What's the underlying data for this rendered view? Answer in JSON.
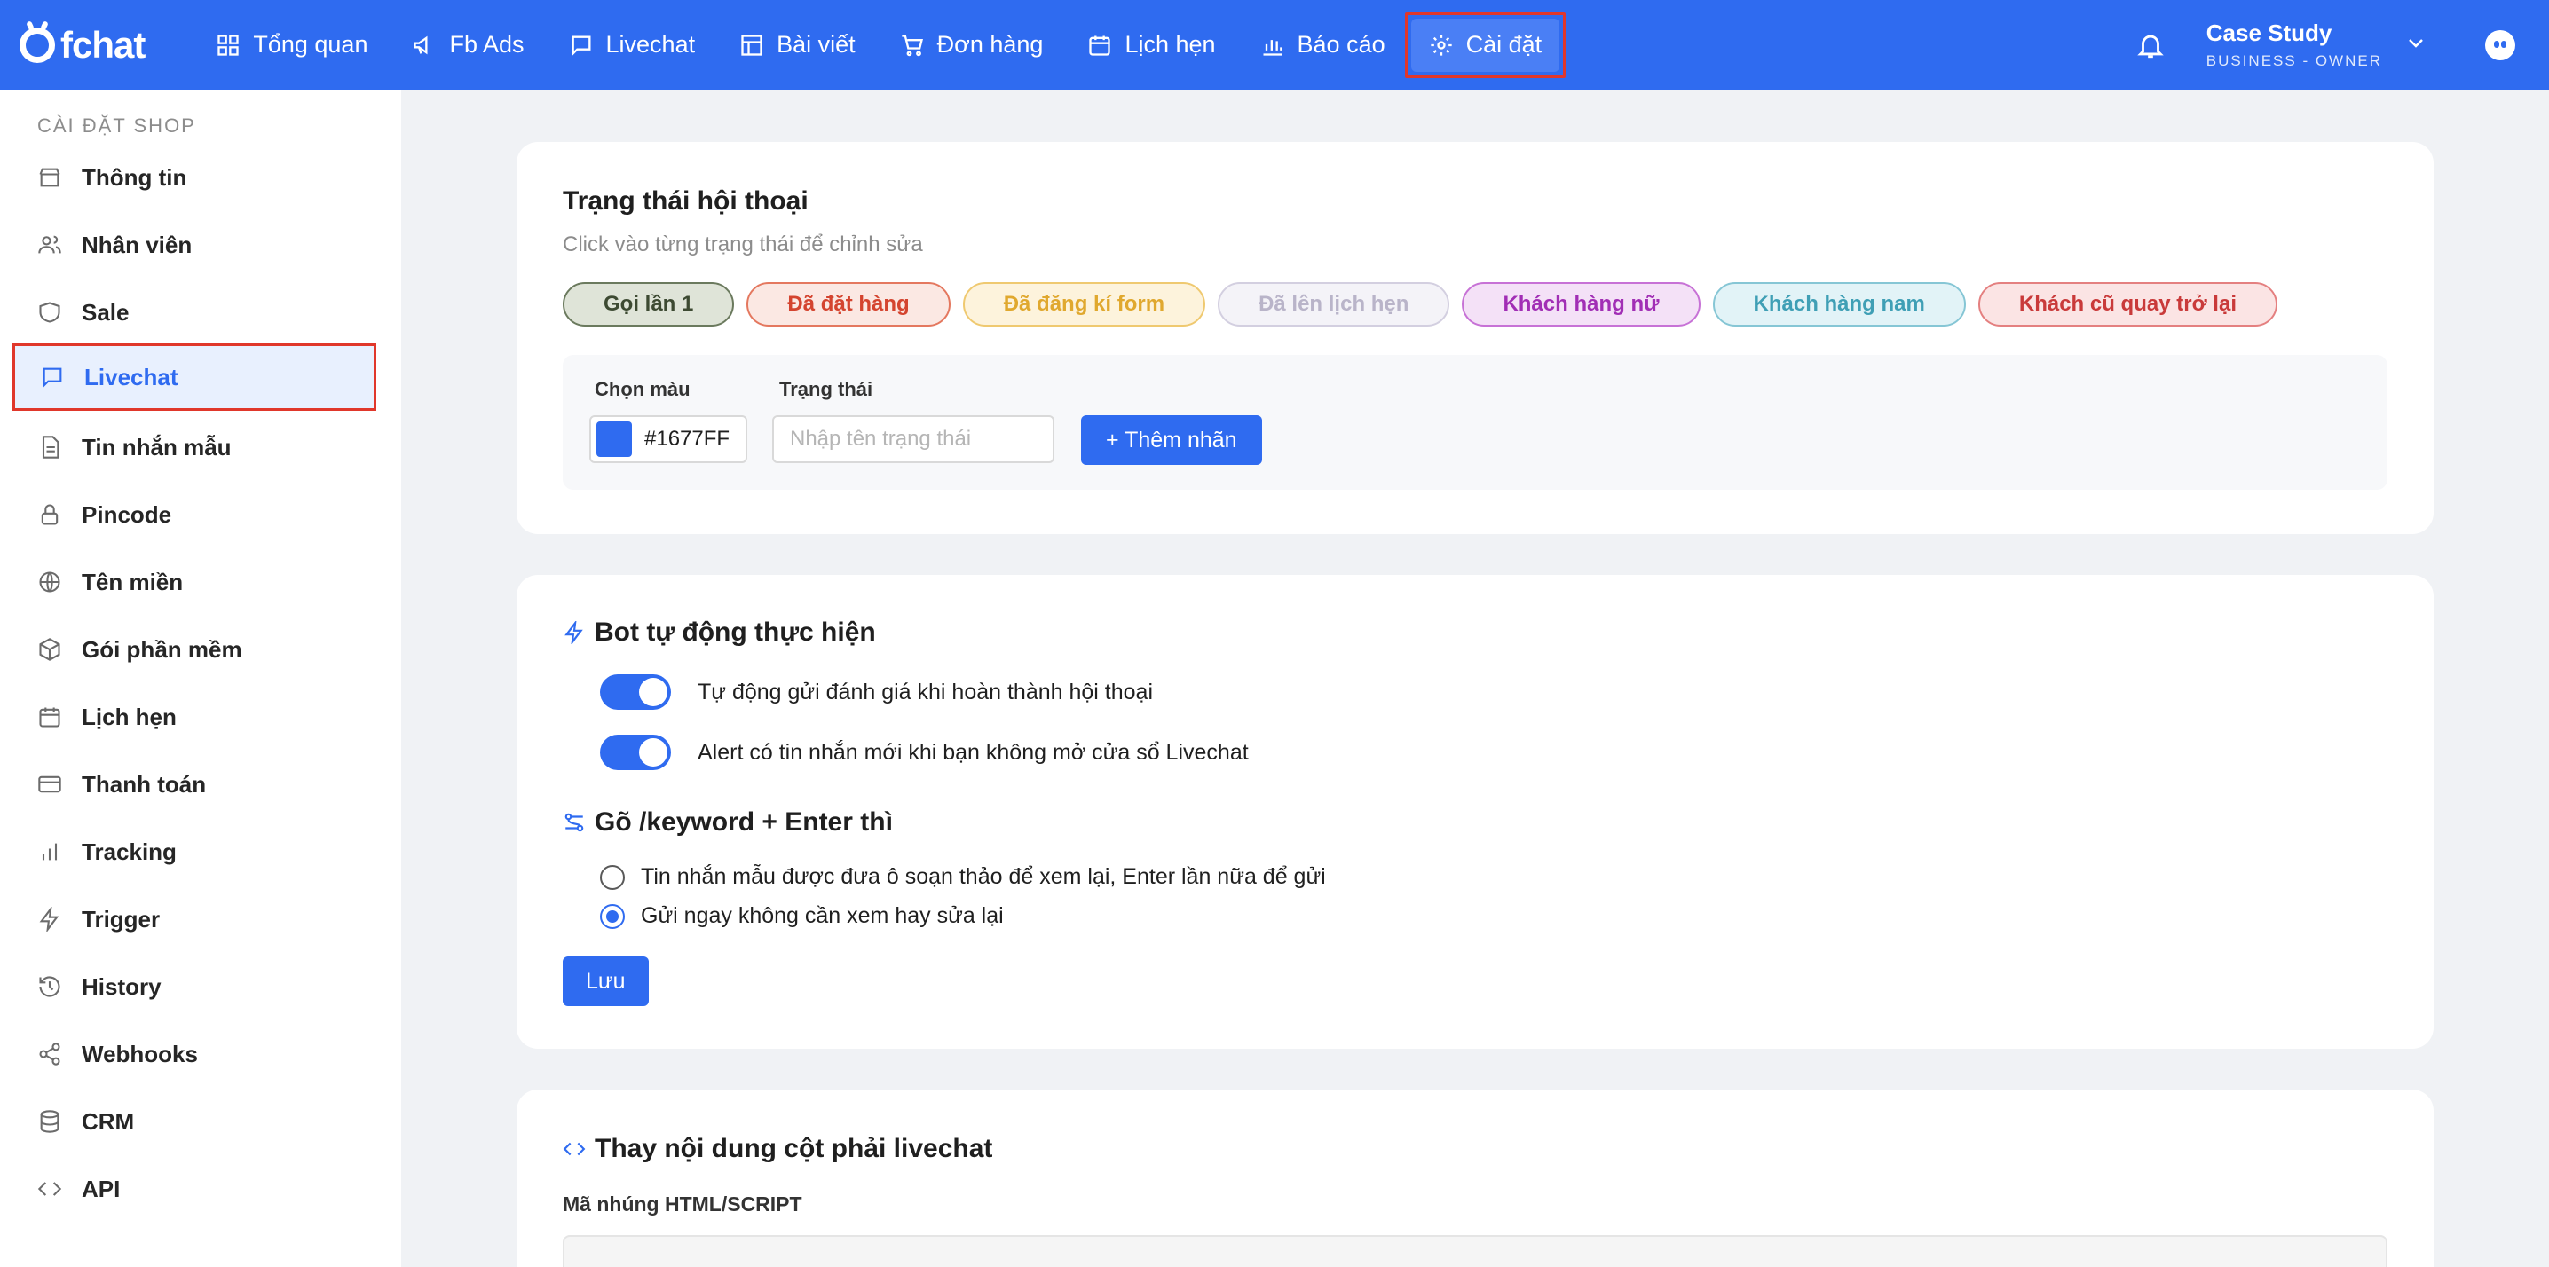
{
  "app": {
    "logo_text": "fchat"
  },
  "nav": {
    "items": [
      {
        "label": "Tổng quan",
        "icon": "dashboard-icon"
      },
      {
        "label": "Fb Ads",
        "icon": "megaphone-icon"
      },
      {
        "label": "Livechat",
        "icon": "chat-icon"
      },
      {
        "label": "Bài viết",
        "icon": "layout-icon"
      },
      {
        "label": "Đơn hàng",
        "icon": "cart-icon"
      },
      {
        "label": "Lịch hẹn",
        "icon": "calendar-icon"
      },
      {
        "label": "Báo cáo",
        "icon": "bar-chart-icon"
      },
      {
        "label": "Cài đặt",
        "icon": "gear-icon",
        "active": true
      }
    ],
    "account_name": "Case Study",
    "account_role": "BUSINESS - OWNER"
  },
  "sidebar": {
    "header": "CÀI ĐẶT SHOP",
    "items": [
      {
        "label": "Thông tin",
        "icon": "shop-icon"
      },
      {
        "label": "Nhân viên",
        "icon": "users-icon"
      },
      {
        "label": "Sale",
        "icon": "tag-icon"
      },
      {
        "label": "Livechat",
        "icon": "chat-icon",
        "active": true
      },
      {
        "label": "Tin nhắn mẫu",
        "icon": "document-icon"
      },
      {
        "label": "Pincode",
        "icon": "lock-icon"
      },
      {
        "label": "Tên miền",
        "icon": "globe-icon"
      },
      {
        "label": "Gói phần mềm",
        "icon": "package-icon"
      },
      {
        "label": "Lịch hẹn",
        "icon": "calendar-icon"
      },
      {
        "label": "Thanh toán",
        "icon": "credit-card-icon"
      },
      {
        "label": "Tracking",
        "icon": "bar-chart-icon"
      },
      {
        "label": "Trigger",
        "icon": "lightning-icon"
      },
      {
        "label": "History",
        "icon": "history-icon"
      },
      {
        "label": "Webhooks",
        "icon": "share-icon"
      },
      {
        "label": "CRM",
        "icon": "database-icon"
      },
      {
        "label": "API",
        "icon": "code-icon"
      }
    ]
  },
  "status_card": {
    "title": "Trạng thái hội thoại",
    "subtitle": "Click vào từng trạng thái để chỉnh sửa",
    "chips": [
      {
        "label": "Gọi lần 1",
        "color": "#3d4a32",
        "bg": "#dfe4d8",
        "border": "#6b7a5e"
      },
      {
        "label": "Đã đặt hàng",
        "color": "#d4442f",
        "bg": "#fbe8e3",
        "border": "#e4785f"
      },
      {
        "label": "Đã đăng kí form",
        "color": "#e0a82e",
        "bg": "#fdf3dc",
        "border": "#efc970"
      },
      {
        "label": "Đã lên lịch hẹn",
        "color": "#b9b4c9",
        "bg": "#f4f3f8",
        "border": "#d3cfe0"
      },
      {
        "label": "Khách hàng nữ",
        "color": "#a12eb5",
        "bg": "#f4e1f7",
        "border": "#c772d6"
      },
      {
        "label": "Khách hàng nam",
        "color": "#3f9fb5",
        "bg": "#e2f3f7",
        "border": "#86c6d5"
      },
      {
        "label": "Khách cũ quay trở lại",
        "color": "#c93a3a",
        "bg": "#fbe4e4",
        "border": "#e48080"
      }
    ],
    "color_label": "Chọn màu",
    "color_value": "#1677FF",
    "status_label": "Trạng thái",
    "status_placeholder": "Nhập tên trạng thái",
    "add_button": "+ Thêm nhãn"
  },
  "bot_card": {
    "title": "Bot tự động thực hiện",
    "toggles": [
      {
        "label": "Tự động gửi đánh giá khi hoàn thành hội thoại",
        "on": true
      },
      {
        "label": "Alert có tin nhắn mới khi bạn không mở cửa sổ Livechat",
        "on": true
      }
    ],
    "keyword_title": "Gõ /keyword + Enter thì",
    "radios": [
      {
        "label": "Tin nhắn mẫu được đưa ô soạn thảo để xem lại, Enter lần nữa để gửi",
        "checked": false
      },
      {
        "label": "Gửi ngay không cần xem hay sửa lại",
        "checked": true
      }
    ],
    "save_button": "Lưu"
  },
  "embed_card": {
    "title": "Thay nội dung cột phải livechat",
    "code_label": "Mã nhúng HTML/SCRIPT"
  }
}
